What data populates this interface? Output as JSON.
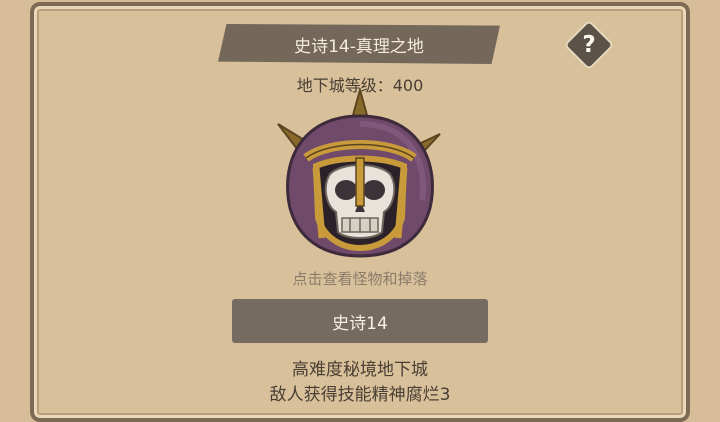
{
  "header": {
    "title": "史诗14-真理之地",
    "help_label": "?"
  },
  "dungeon": {
    "level_text": "地下城等级：400"
  },
  "boss": {
    "icon": "armored-skull-boss-icon",
    "hint": "点击查看怪物和掉落"
  },
  "difficulty": {
    "label": "史诗14"
  },
  "description": {
    "line1": "高难度秘境地下城",
    "line2": "敌人获得技能精神腐烂3"
  },
  "colors": {
    "background": "#d8c09a",
    "banner": "#74685b",
    "button": "#756b60",
    "helmet": "#6f4a6b",
    "trim": "#c99a3a"
  }
}
